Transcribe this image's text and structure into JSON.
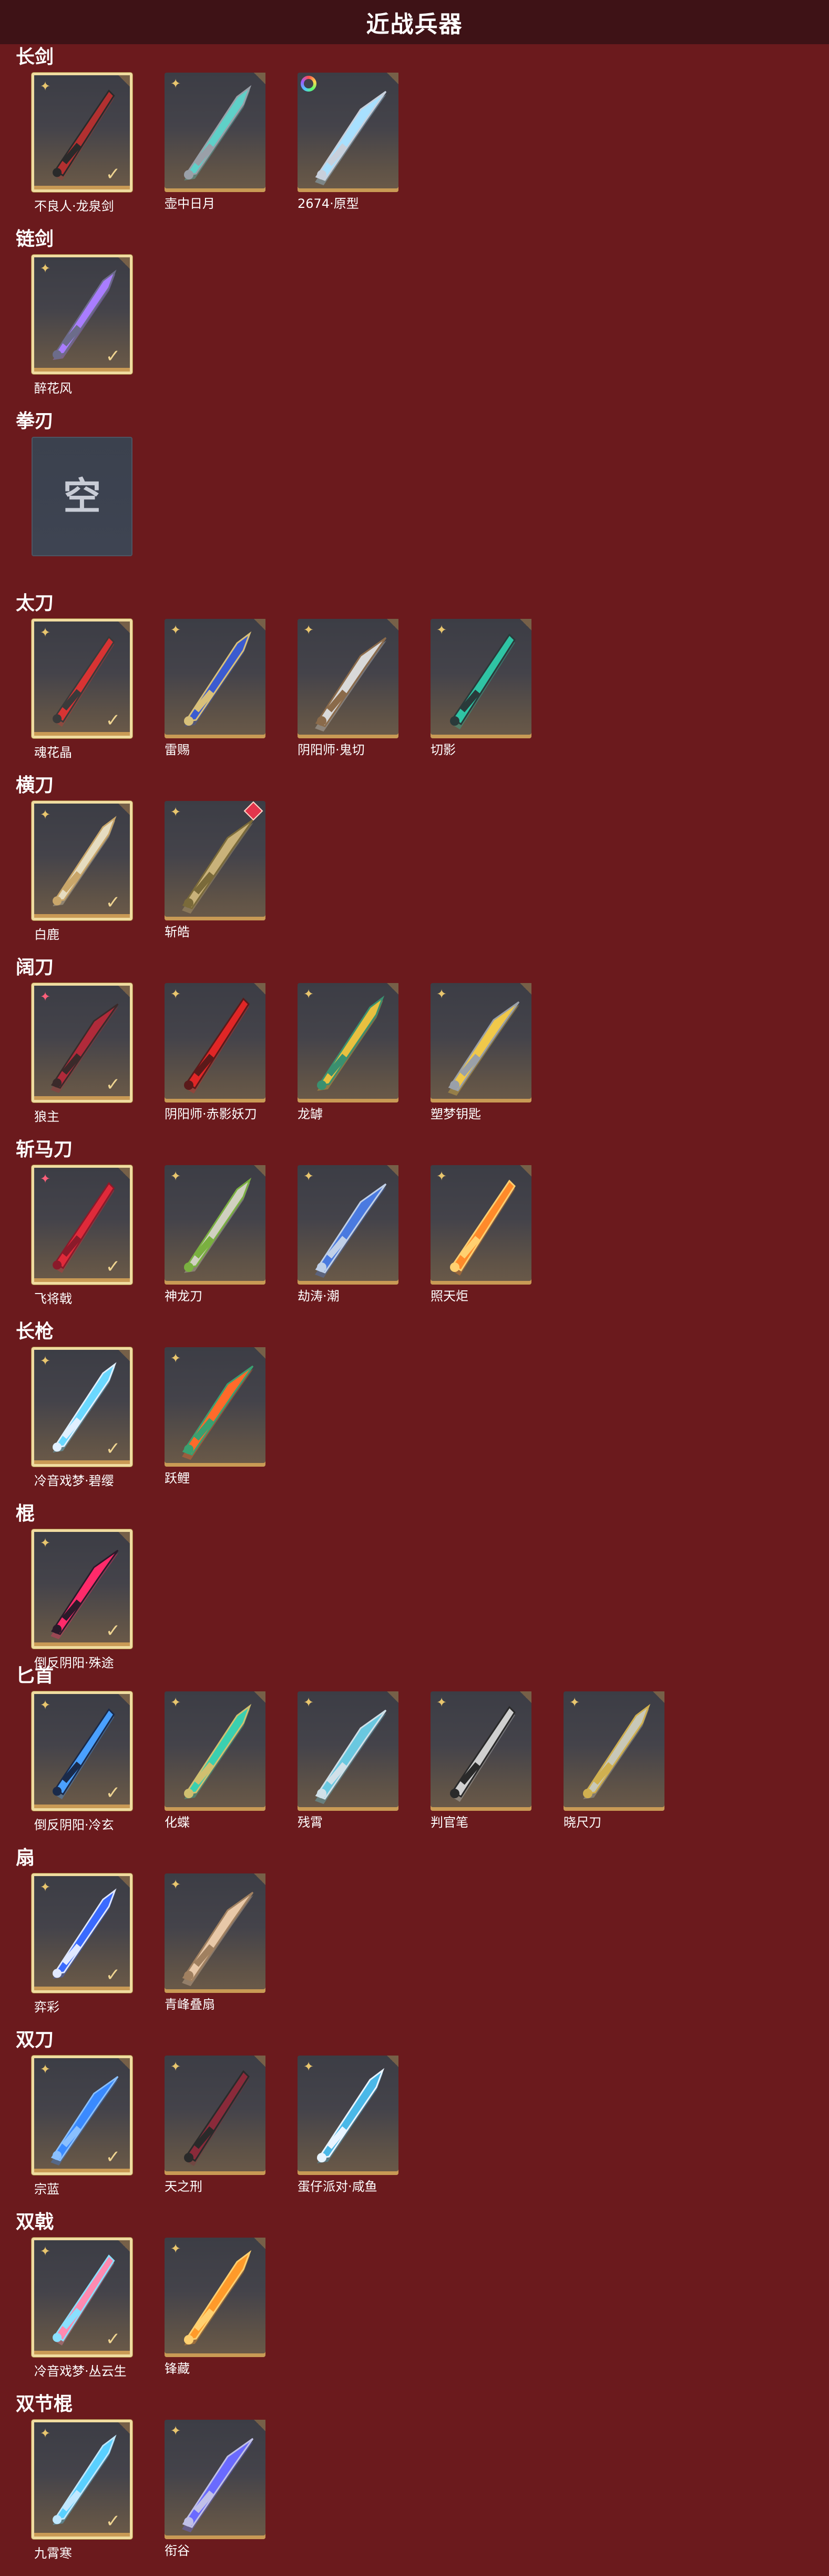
{
  "page_title": "近战兵器",
  "colors": {
    "background": "#6b1a1d",
    "header": "#3e1216",
    "owned_border": "#f0dca0",
    "accent": "#c99a55"
  },
  "empty_label": "空",
  "categories": [
    {
      "title": "长剑",
      "items": [
        {
          "name": "不良人·龙泉剑",
          "owned": true,
          "badge": "star",
          "theme": [
            "#b23030",
            "#2a2a2a"
          ]
        },
        {
          "name": "壶中日月",
          "owned": false,
          "badge": "star",
          "theme": [
            "#5fd0c8",
            "#9aa0a8"
          ]
        },
        {
          "name": "2674·原型",
          "owned": false,
          "badge": "ring",
          "theme": [
            "#a8e0ff",
            "#c8d0dc"
          ]
        }
      ]
    },
    {
      "title": "链剑",
      "items": [
        {
          "name": "醉花风",
          "owned": true,
          "badge": "star",
          "theme": [
            "#a97dff",
            "#6c6c8a"
          ]
        }
      ]
    },
    {
      "title": "拳刃",
      "items": [
        {
          "name": "",
          "owned": false,
          "empty": true
        }
      ]
    },
    {
      "title": "太刀",
      "items": [
        {
          "name": "魂花晶",
          "owned": true,
          "badge": "star",
          "theme": [
            "#d83333",
            "#3a3a3a"
          ]
        },
        {
          "name": "雷赐",
          "owned": false,
          "badge": "star",
          "theme": [
            "#3b5bd0",
            "#d8c07a"
          ]
        },
        {
          "name": "阴阳师·鬼切",
          "owned": false,
          "badge": "star",
          "theme": [
            "#d9d9d9",
            "#8a6a4a"
          ]
        },
        {
          "name": "切影",
          "owned": false,
          "badge": "star",
          "theme": [
            "#2fc4a4",
            "#2a3a3a"
          ]
        }
      ]
    },
    {
      "title": "横刀",
      "items": [
        {
          "name": "白鹿",
          "owned": true,
          "badge": "star",
          "theme": [
            "#e6dcc0",
            "#c9a66a"
          ]
        },
        {
          "name": "斩皓",
          "owned": false,
          "badge": "star",
          "gem": true,
          "theme": [
            "#c9b27a",
            "#7a6a3a"
          ]
        }
      ]
    },
    {
      "title": "阔刀",
      "items": [
        {
          "name": "狼主",
          "owned": true,
          "badge": "star-red",
          "theme": [
            "#b02a3a",
            "#3a2a2a"
          ]
        },
        {
          "name": "阴阳师·赤影妖刀",
          "owned": false,
          "badge": "star",
          "theme": [
            "#e02626",
            "#5a1a1a"
          ]
        },
        {
          "name": "龙罅",
          "owned": false,
          "badge": "star",
          "theme": [
            "#e8c040",
            "#3a9070"
          ]
        },
        {
          "name": "塑梦钥匙",
          "owned": false,
          "badge": "star",
          "theme": [
            "#f0c84a",
            "#9aa0a8"
          ]
        }
      ]
    },
    {
      "title": "斩马刀",
      "items": [
        {
          "name": "飞将戟",
          "owned": true,
          "badge": "star-red",
          "theme": [
            "#e02a3a",
            "#8a1a2a"
          ]
        },
        {
          "name": "神龙刀",
          "owned": false,
          "badge": "star",
          "theme": [
            "#d0d0c0",
            "#7ab040"
          ]
        },
        {
          "name": "劫涛·潮",
          "owned": false,
          "badge": "star",
          "theme": [
            "#4a7ae0",
            "#c0d0e8"
          ]
        },
        {
          "name": "照天炬",
          "owned": false,
          "badge": "star",
          "theme": [
            "#ff8a2a",
            "#ffd070"
          ]
        }
      ]
    },
    {
      "title": "长枪",
      "items": [
        {
          "name": "冷音戏梦·碧缨",
          "owned": true,
          "badge": "star",
          "theme": [
            "#6ad8ff",
            "#e0f0ff"
          ]
        },
        {
          "name": "跃鲤",
          "owned": false,
          "badge": "star",
          "theme": [
            "#ff6a2a",
            "#3aa070"
          ]
        }
      ]
    },
    {
      "title": "棍",
      "items": [
        {
          "name": "倒反阴阳·殊途",
          "owned": true,
          "badge": "star",
          "theme": [
            "#ff2a6a",
            "#2a1a2a"
          ]
        }
      ]
    },
    {
      "title": "匕首",
      "items": [
        {
          "name": "倒反阴阳·冷玄",
          "owned": true,
          "badge": "star",
          "theme": [
            "#4aa0ff",
            "#1a2a4a"
          ]
        },
        {
          "name": "化蝶",
          "owned": false,
          "badge": "star",
          "theme": [
            "#3ad0b0",
            "#d0c070"
          ]
        },
        {
          "name": "残霄",
          "owned": false,
          "badge": "star",
          "theme": [
            "#6ac8e0",
            "#d0e0e8"
          ]
        },
        {
          "name": "判官笔",
          "owned": false,
          "badge": "star",
          "theme": [
            "#d0d0d0",
            "#2a2a2a"
          ]
        },
        {
          "name": "晓尺刀",
          "owned": false,
          "badge": "star",
          "theme": [
            "#c8c8b8",
            "#d0b050"
          ]
        }
      ]
    },
    {
      "title": "扇",
      "items": [
        {
          "name": "弈彩",
          "owned": true,
          "badge": "star",
          "theme": [
            "#3a6aff",
            "#e0e8ff"
          ]
        },
        {
          "name": "青峰叠扇",
          "owned": false,
          "badge": "star",
          "theme": [
            "#e8c8a8",
            "#a08060"
          ]
        }
      ]
    },
    {
      "title": "双刀",
      "items": [
        {
          "name": "宗蓝",
          "owned": true,
          "badge": "star",
          "theme": [
            "#3a8aff",
            "#8ac0ff"
          ]
        },
        {
          "name": "天之刑",
          "owned": false,
          "badge": "star",
          "theme": [
            "#8a2a3a",
            "#2a2a2a"
          ]
        },
        {
          "name": "蛋仔派对·咸鱼",
          "owned": false,
          "badge": "star",
          "theme": [
            "#4ab8e8",
            "#e8f4ff"
          ]
        }
      ]
    },
    {
      "title": "双戟",
      "items": [
        {
          "name": "冷音戏梦·丛云生",
          "owned": true,
          "badge": "star",
          "theme": [
            "#ff8ab0",
            "#8ae0ff"
          ]
        },
        {
          "name": "锋藏",
          "owned": false,
          "badge": "star",
          "theme": [
            "#ff9a2a",
            "#ffd070"
          ]
        }
      ]
    },
    {
      "title": "双节棍",
      "items": [
        {
          "name": "九霄寒",
          "owned": true,
          "badge": "star",
          "theme": [
            "#5ad0ff",
            "#c0e8ff"
          ]
        },
        {
          "name": "衔谷",
          "owned": false,
          "badge": "star",
          "theme": [
            "#6a6aff",
            "#c0c0e8"
          ]
        }
      ]
    }
  ]
}
